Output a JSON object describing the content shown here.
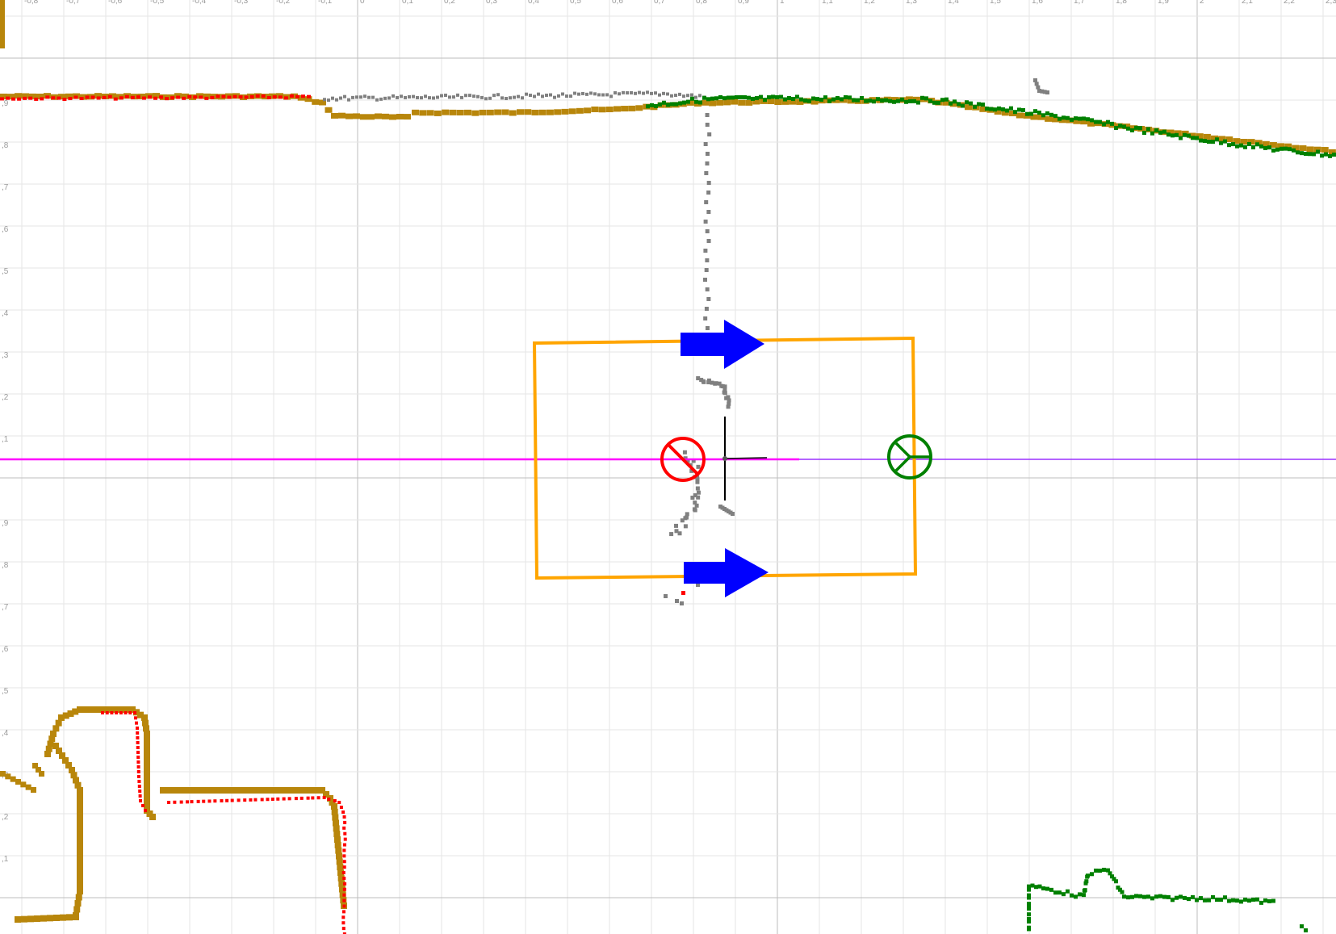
{
  "axes": {
    "x_tick_labels": [
      "-0,8",
      "-0,7",
      "-0,6",
      "-0,5",
      "-0,4",
      "-0,3",
      "-0,2",
      "-0,1",
      "0",
      "0,1",
      "0,2",
      "0,3",
      "0,4",
      "0,5",
      "0,6",
      "0,7",
      "0,8",
      "0,9",
      "1",
      "1,1",
      "1,2",
      "1,3",
      "1,4",
      "1,5",
      "1,6",
      "1,7",
      "1,8",
      "1,9",
      "2",
      "2,1",
      "2,2",
      "2,3"
    ],
    "y_tick_labels_upper": [
      ",9",
      ",8",
      ",7",
      ",6",
      ",5",
      ",4",
      ",3",
      ",2",
      ",1"
    ],
    "y_tick_labels_lower": [
      ",9",
      ",8",
      ",7",
      ",6",
      ",5",
      ",4",
      ",3",
      ",2",
      ",1"
    ]
  },
  "colors": {
    "background": "#ffffff",
    "grid_minor": "#e6e6e6",
    "grid_major": "#bdbdbd",
    "ochre_track": "#b8860b",
    "red_points": "#ff0000",
    "gray_points": "#808080",
    "green_points": "#008000",
    "robot_box": "#ffa500",
    "arrow": "#0000ff",
    "heading_line_left": "#ff00ff",
    "heading_line_right": "#9b30ff",
    "start_marker": "#ff0000",
    "goal_marker": "#008000"
  },
  "icons": {
    "start_marker": "circle-slash-icon",
    "goal_marker": "circle-y-icon",
    "direction_arrow": "arrow-right-icon"
  }
}
